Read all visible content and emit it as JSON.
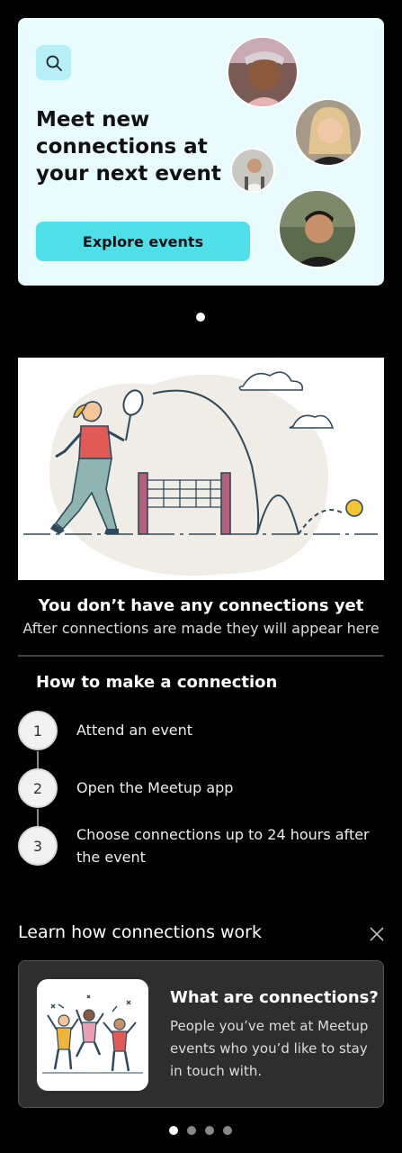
{
  "hero": {
    "title": "Meet new connections at your next event",
    "explore_button": "Explore events",
    "search_icon": "search-icon"
  },
  "pagination": {
    "count": 1,
    "active": 0
  },
  "empty_state": {
    "title": "You don’t have any connections yet",
    "subtitle": "After connections are made they will appear here"
  },
  "how_to": {
    "title": "How to make a connection",
    "steps": [
      {
        "number": "1",
        "text": "Attend an event"
      },
      {
        "number": "2",
        "text": "Open the Meetup app"
      },
      {
        "number": "3",
        "text": "Choose connections up to 24 hours after the event"
      }
    ]
  },
  "learn": {
    "title": "Learn how connections work",
    "close_icon": "close-icon",
    "card": {
      "title": "What are connections?",
      "body": "People you’ve met at Meetup events who you’d like to stay in touch with."
    },
    "carousel": {
      "count": 4,
      "active": 0
    }
  },
  "colors": {
    "background": "#000000",
    "hero_bg": "#e8fbfd",
    "accent": "#4fdfe9",
    "card_bg": "#2e2e2e"
  }
}
